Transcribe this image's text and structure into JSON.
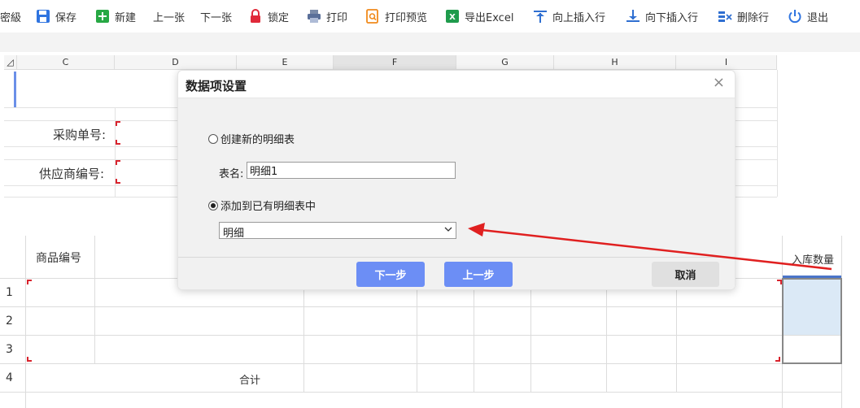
{
  "toolbar": {
    "items": [
      {
        "label": "密級",
        "icon": "password-level-icon"
      },
      {
        "label": "保存",
        "icon": "save-icon"
      },
      {
        "label": "新建",
        "icon": "new-icon"
      },
      {
        "label": "上一张",
        "icon": ""
      },
      {
        "label": "下一张",
        "icon": ""
      },
      {
        "label": "锁定",
        "icon": "lock-icon"
      },
      {
        "label": "打印",
        "icon": "print-icon"
      },
      {
        "label": "打印预览",
        "icon": "print-preview-icon"
      },
      {
        "label": "导出Excel",
        "icon": "excel-icon"
      },
      {
        "label": "向上插入行",
        "icon": "insert-row-above-icon"
      },
      {
        "label": "向下插入行",
        "icon": "insert-row-below-icon"
      },
      {
        "label": "删除行",
        "icon": "delete-row-icon"
      },
      {
        "label": "退出",
        "icon": "exit-icon"
      }
    ]
  },
  "sheet": {
    "corner": "◿",
    "columns": [
      "C",
      "D",
      "E",
      "F",
      "G",
      "H",
      "I"
    ],
    "fields": {
      "purchase_no_label": "采购单号:",
      "supplier_no_label": "供应商编号:"
    }
  },
  "detail": {
    "headers": {
      "product_no": "商品编号",
      "stock_in_qty": "入库数量"
    },
    "row_numbers": [
      "1",
      "2",
      "3",
      "4"
    ],
    "total_label": "合计"
  },
  "dialog": {
    "title": "数据项设置",
    "close": "×",
    "option_new": "创建新的明细表",
    "table_name_label": "表名:",
    "table_name_value": "明细1",
    "option_existing": "添加到已有明细表中",
    "existing_selected": "明细",
    "next_button": "下一步",
    "prev_button": "上一步",
    "cancel_button": "取消"
  },
  "colors": {
    "primary_button": "#6c8ef5",
    "annotation_arrow": "#e02020",
    "required_marker": "#d9232d",
    "selected_cell": "#dbe9f6"
  }
}
